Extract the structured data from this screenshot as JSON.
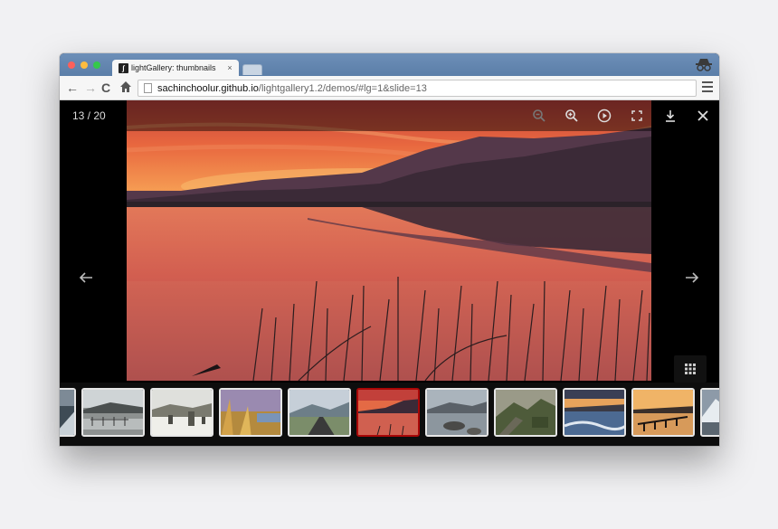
{
  "browser": {
    "tab_title": "lightGallery: thumbnails",
    "tab_close": "×",
    "favicon_letter": "lg",
    "url_host": "sachinchoolur.github.io",
    "url_path": "/lightgallery1.2/demos/#lg=1&slide=13",
    "nav": {
      "back": "←",
      "forward": "→",
      "reload": "C"
    }
  },
  "gallery": {
    "counter": "13 / 20",
    "current_slide": 13,
    "total_slides": 20,
    "toolbar_icons": [
      "zoom-out-icon",
      "zoom-in-icon",
      "autoplay-icon",
      "fullscreen-icon",
      "download-icon",
      "close-icon"
    ],
    "prev_icon": "arrow-left-icon",
    "next_icon": "arrow-right-icon",
    "thumbnail_toggle_icon": "grid-icon",
    "accent": "#a90707"
  },
  "thumbnails": [
    {
      "scene": "coast-partial",
      "active": false
    },
    {
      "scene": "flooded-fence",
      "active": false
    },
    {
      "scene": "stone-circle-snow",
      "active": false
    },
    {
      "scene": "autumn-grass",
      "active": false
    },
    {
      "scene": "road-hills",
      "active": false
    },
    {
      "scene": "lake-sunset",
      "active": true
    },
    {
      "scene": "tarn-rocks",
      "active": false
    },
    {
      "scene": "stone-wall-valley",
      "active": false
    },
    {
      "scene": "waves-sunset",
      "active": false
    },
    {
      "scene": "jetty-sunset",
      "active": false
    },
    {
      "scene": "snow-peak-partial",
      "active": false
    }
  ]
}
